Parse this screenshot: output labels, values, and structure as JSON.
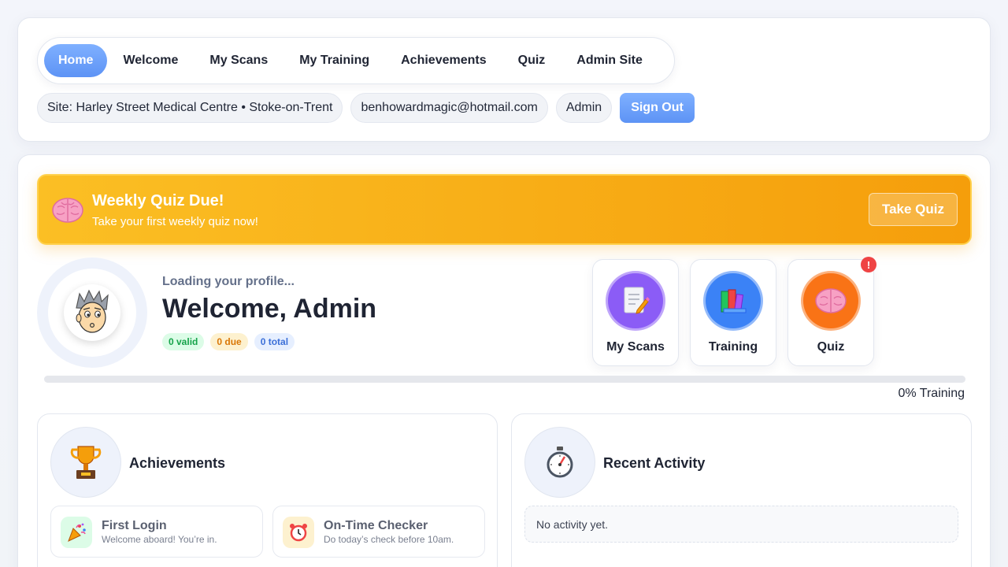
{
  "nav": {
    "tabs": [
      {
        "label": "Home",
        "active": true
      },
      {
        "label": "Welcome"
      },
      {
        "label": "My Scans"
      },
      {
        "label": "My Training"
      },
      {
        "label": "Achievements"
      },
      {
        "label": "Quiz"
      },
      {
        "label": "Admin Site"
      }
    ]
  },
  "meta": {
    "site": "Site: Harley Street Medical Centre • Stoke-on-Trent",
    "email": "benhowardmagic@hotmail.com",
    "role": "Admin",
    "sign_out": "Sign Out"
  },
  "banner": {
    "icon": "brain-icon",
    "title": "Weekly Quiz Due!",
    "subtitle": "Take your first weekly quiz now!",
    "action": "Take Quiz"
  },
  "profile": {
    "loading": "Loading your profile...",
    "welcome": "Welcome, Admin",
    "badges": {
      "valid": "0 valid",
      "due": "0 due",
      "total": "0 total"
    }
  },
  "tiles": [
    {
      "label": "My Scans",
      "icon": "document-pencil-icon",
      "color": "#8b5cf6"
    },
    {
      "label": "Training",
      "icon": "books-icon",
      "color": "#3b82f6"
    },
    {
      "label": "Quiz",
      "icon": "brain-icon",
      "color": "#f97316",
      "alert": "!"
    }
  ],
  "progress": {
    "value": 0,
    "label": "0% Training"
  },
  "achievements": {
    "title": "Achievements",
    "icon": "trophy-icon",
    "items": [
      {
        "title": "First Login",
        "desc": "Welcome aboard! You’re in.",
        "icon": "party-popper-icon"
      },
      {
        "title": "On-Time Checker",
        "desc": "Do today’s check before 10am.",
        "icon": "alarm-clock-icon"
      }
    ]
  },
  "activity": {
    "title": "Recent Activity",
    "icon": "stopwatch-icon",
    "empty": "No activity yet."
  },
  "colors": {
    "accent": "#5d93f5",
    "banner": "#f59e0b",
    "alert": "#ef4444"
  }
}
